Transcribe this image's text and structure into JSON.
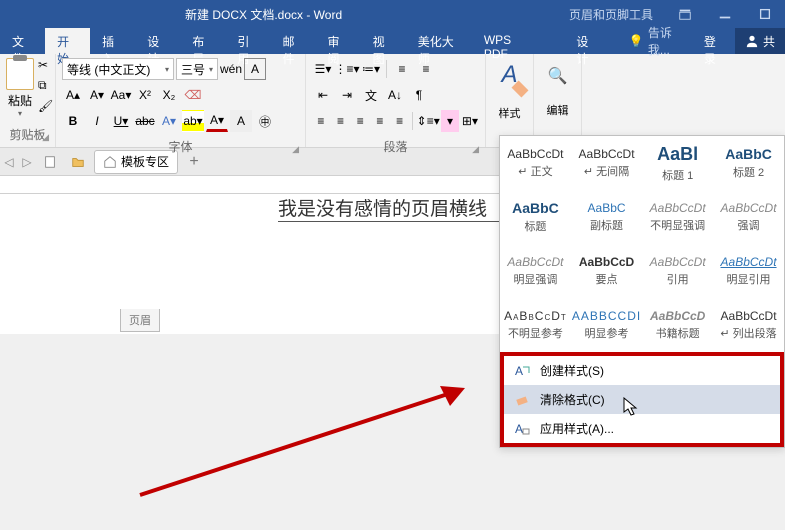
{
  "title": "新建 DOCX 文档.docx - Word",
  "context_tab": "页眉和页脚工具",
  "context_design": "设计",
  "tell_me": "告诉我...",
  "login": "登录",
  "share": "共",
  "tabs": {
    "file": "文件",
    "home": "开始",
    "insert": "插入",
    "design": "设计",
    "layout": "布局",
    "references": "引用",
    "mailings": "邮件",
    "review": "审阅",
    "view": "视图",
    "beautify": "美化大师",
    "wps": "WPS PDF"
  },
  "ribbon": {
    "paste": "粘贴",
    "clipboard": "剪贴板",
    "font_name": "等线 (中文正文)",
    "font_size": "三号",
    "font_group": "字体",
    "para_group": "段落",
    "styles": "样式",
    "edit": "编辑"
  },
  "doc_tabs": {
    "template": "模板专区"
  },
  "document": {
    "header_text": "我是没有感情的页眉横线",
    "header_tag": "页眉"
  },
  "styles_gallery": [
    {
      "preview": "AaBbCcDt",
      "label": "↵ 正文",
      "cls": ""
    },
    {
      "preview": "AaBbCcDt",
      "label": "↵ 无间隔",
      "cls": ""
    },
    {
      "preview": "AaBl",
      "label": "标题 1",
      "cls": "big"
    },
    {
      "preview": "AaBbC",
      "label": "标题 2",
      "cls": "med"
    },
    {
      "preview": "AaBbC",
      "label": "标题",
      "cls": "med"
    },
    {
      "preview": "AaBbC",
      "label": "副标题",
      "cls": "blue"
    },
    {
      "preview": "AaBbCcDt",
      "label": "不明显强调",
      "cls": "italic"
    },
    {
      "preview": "AaBbCcDt",
      "label": "强调",
      "cls": "italic blue"
    },
    {
      "preview": "AaBbCcDt",
      "label": "明显强调",
      "cls": "italic blue"
    },
    {
      "preview": "AaBbCcD",
      "label": "要点",
      "cls": "bold"
    },
    {
      "preview": "AaBbCcDt",
      "label": "引用",
      "cls": "italic"
    },
    {
      "preview": "AaBbCcDt",
      "label": "明显引用",
      "cls": "italic under"
    },
    {
      "preview": "AaBbCcDt",
      "label": "不明显参考",
      "cls": "caps"
    },
    {
      "preview": "AABBCCDI",
      "label": "明显参考",
      "cls": "caps blue"
    },
    {
      "preview": "AaBbCcD",
      "label": "书籍标题",
      "cls": "bold italic"
    },
    {
      "preview": "AaBbCcDt",
      "label": "↵ 列出段落",
      "cls": ""
    }
  ],
  "styles_footer": {
    "create": "创建样式(S)",
    "clear": "清除格式(C)",
    "apply": "应用样式(A)..."
  }
}
